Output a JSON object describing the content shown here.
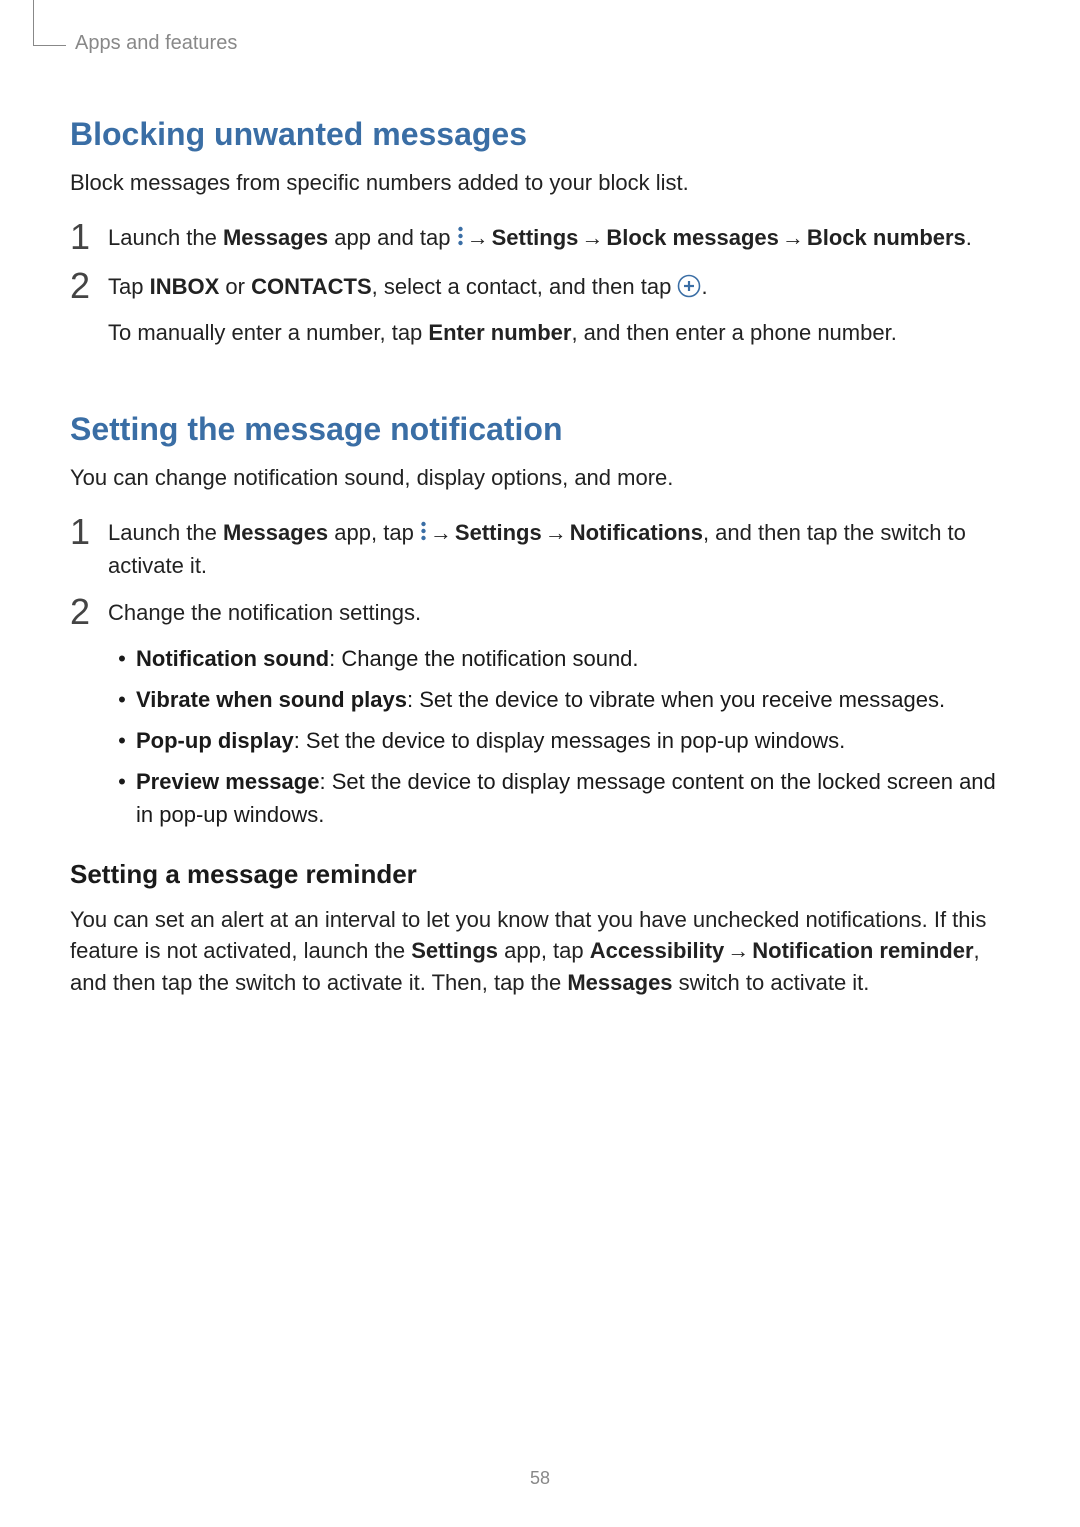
{
  "breadcrumb": "Apps and features",
  "section1": {
    "heading": "Blocking unwanted messages",
    "intro": "Block messages from specific numbers added to your block list.",
    "step1": {
      "num": "1",
      "pre": "Launch the ",
      "app": "Messages",
      "mid": " app and tap ",
      "arrow1": " → ",
      "settings": "Settings",
      "arrow2": " → ",
      "block_messages": "Block messages",
      "arrow3": " → ",
      "block_numbers": "Block numbers",
      "end": "."
    },
    "step2": {
      "num": "2",
      "pre": "Tap ",
      "inbox": "INBOX",
      "or": " or ",
      "contacts": "CONTACTS",
      "mid": ", select a contact, and then tap ",
      "end": ".",
      "sub_pre": "To manually enter a number, tap ",
      "sub_enter": "Enter number",
      "sub_end": ", and then enter a phone number."
    }
  },
  "section2": {
    "heading": "Setting the message notification",
    "intro": "You can change notification sound, display options, and more.",
    "step1": {
      "num": "1",
      "pre": "Launch the ",
      "app": "Messages",
      "mid": " app, tap ",
      "arrow1": " → ",
      "settings": "Settings",
      "arrow2": " → ",
      "notifications": "Notifications",
      "end": ", and then tap the switch to activate it."
    },
    "step2": {
      "num": "2",
      "text": "Change the notification settings."
    },
    "bullets": {
      "b1_label": "Notification sound",
      "b1_desc": ": Change the notification sound.",
      "b2_label": "Vibrate when sound plays",
      "b2_desc": ": Set the device to vibrate when you receive messages.",
      "b3_label": "Pop-up display",
      "b3_desc": ": Set the device to display messages in pop-up windows.",
      "b4_label": "Preview message",
      "b4_desc": ": Set the device to display message content on the locked screen and in pop-up windows."
    }
  },
  "section3": {
    "heading": "Setting a message reminder",
    "para_1": "You can set an alert at an interval to let you know that you have unchecked notifications. If this feature is not activated, launch the ",
    "settings_app": "Settings",
    "para_2": " app, tap ",
    "accessibility": "Accessibility",
    "arrow": " → ",
    "notif_reminder": "Notification reminder",
    "para_3": ", and then tap the switch to activate it. Then, tap the ",
    "messages": "Messages",
    "para_4": " switch to activate it."
  },
  "page_number": "58",
  "bullet_char": "•",
  "icon_names": {
    "more_vert": "more-options-icon",
    "add_circle": "add-icon"
  }
}
